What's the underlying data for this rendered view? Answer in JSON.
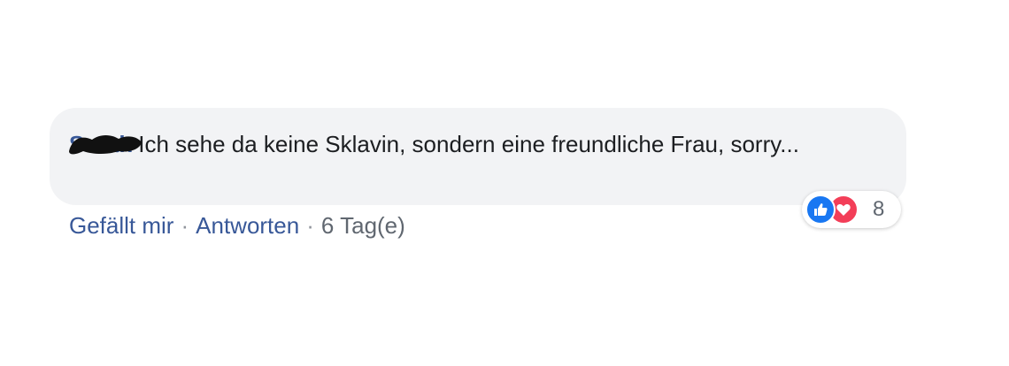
{
  "comment": {
    "author": "Sarah",
    "text": "Ich sehe da keine Sklavin, sondern eine freundliche Frau, sorry..."
  },
  "reactions": {
    "icons": [
      "like-icon",
      "love-icon"
    ],
    "count": "8",
    "colors": {
      "like": "#1877f2",
      "love": "#f33e58"
    }
  },
  "actions": {
    "like_label": "Gefällt mir",
    "reply_label": "Antworten",
    "separator": "·",
    "timestamp": "6 Tag(e)"
  }
}
